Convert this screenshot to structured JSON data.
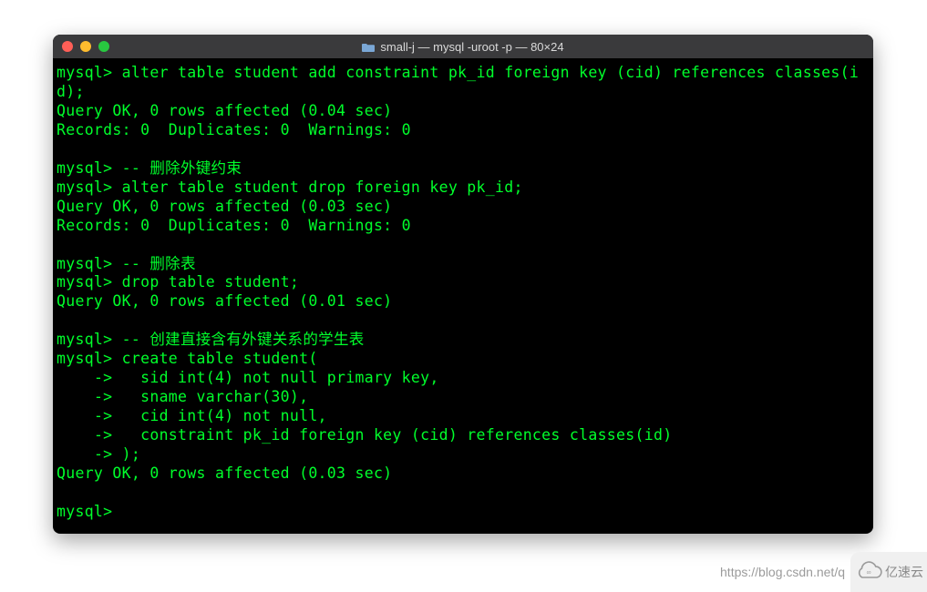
{
  "window": {
    "title": "small-j — mysql -uroot -p — 80×24"
  },
  "terminal": {
    "lines": [
      "mysql> alter table student add constraint pk_id foreign key (cid) references classes(id);",
      "Query OK, 0 rows affected (0.04 sec)",
      "Records: 0  Duplicates: 0  Warnings: 0",
      "",
      "mysql> -- 删除外键约束",
      "mysql> alter table student drop foreign key pk_id;",
      "Query OK, 0 rows affected (0.03 sec)",
      "Records: 0  Duplicates: 0  Warnings: 0",
      "",
      "mysql> -- 删除表",
      "mysql> drop table student;",
      "Query OK, 0 rows affected (0.01 sec)",
      "",
      "mysql> -- 创建直接含有外键关系的学生表",
      "mysql> create table student(",
      "    ->   sid int(4) not null primary key,",
      "    ->   sname varchar(30),",
      "    ->   cid int(4) not null,",
      "    ->   constraint pk_id foreign key (cid) references classes(id)",
      "    -> );",
      "Query OK, 0 rows affected (0.03 sec)",
      "",
      "mysql> "
    ]
  },
  "watermark": {
    "url": "https://blog.csdn.net/q",
    "badge": "亿速云"
  },
  "colors": {
    "terminal_bg": "#000000",
    "terminal_fg": "#00ff2b",
    "titlebar_bg": "#3a3a3c"
  }
}
